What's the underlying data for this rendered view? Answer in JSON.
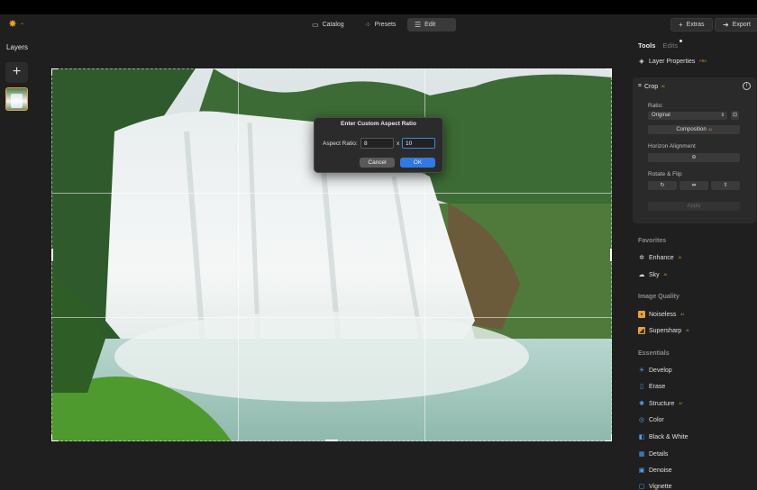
{
  "toolbar": {
    "catalog_label": "Catalog",
    "presets_label": "Presets",
    "edit_label": "Edit",
    "extras_label": "Extras",
    "export_label": "Export"
  },
  "layers": {
    "title": "Layers",
    "add_glyph": "+"
  },
  "dialog": {
    "title": "Enter Custom Aspect Ratio",
    "label": "Aspect Ratio:",
    "value_a": "8",
    "separator": "x",
    "value_b": "10",
    "cancel_label": "Cancel",
    "ok_label": "OK"
  },
  "panel": {
    "tab_tools": "Tools",
    "tab_edits": "Edits",
    "layer_properties": "Layer Properties",
    "layer_properties_badge": "PRO",
    "crop": {
      "title": "Crop",
      "title_badge": "AI",
      "ratio_label": "Ratio:",
      "ratio_value": "Original",
      "composition_label": "Composition",
      "composition_badge": "AI",
      "horizon_label": "Horizon Alignment",
      "rotate_label": "Rotate & Flip",
      "apply_label": "Apply"
    },
    "favorites_title": "Favorites",
    "favorites": [
      {
        "label": "Enhance",
        "badge": "AI"
      },
      {
        "label": "Sky",
        "badge": "AI"
      }
    ],
    "image_quality_title": "Image Quality",
    "image_quality": [
      {
        "label": "Noiseless",
        "badge": "AI"
      },
      {
        "label": "Supersharp",
        "badge": "AI"
      }
    ],
    "essentials_title": "Essentials",
    "essentials": [
      {
        "label": "Develop",
        "badge": ""
      },
      {
        "label": "Erase",
        "badge": ""
      },
      {
        "label": "Structure",
        "badge": "AI"
      },
      {
        "label": "Color",
        "badge": ""
      },
      {
        "label": "Black & White",
        "badge": ""
      },
      {
        "label": "Details",
        "badge": ""
      },
      {
        "label": "Denoise",
        "badge": ""
      },
      {
        "label": "Vignette",
        "badge": ""
      }
    ]
  },
  "colors": {
    "accent": "#2f7ae5",
    "badge": "#e8a03a",
    "selection": "#e6a23c"
  }
}
